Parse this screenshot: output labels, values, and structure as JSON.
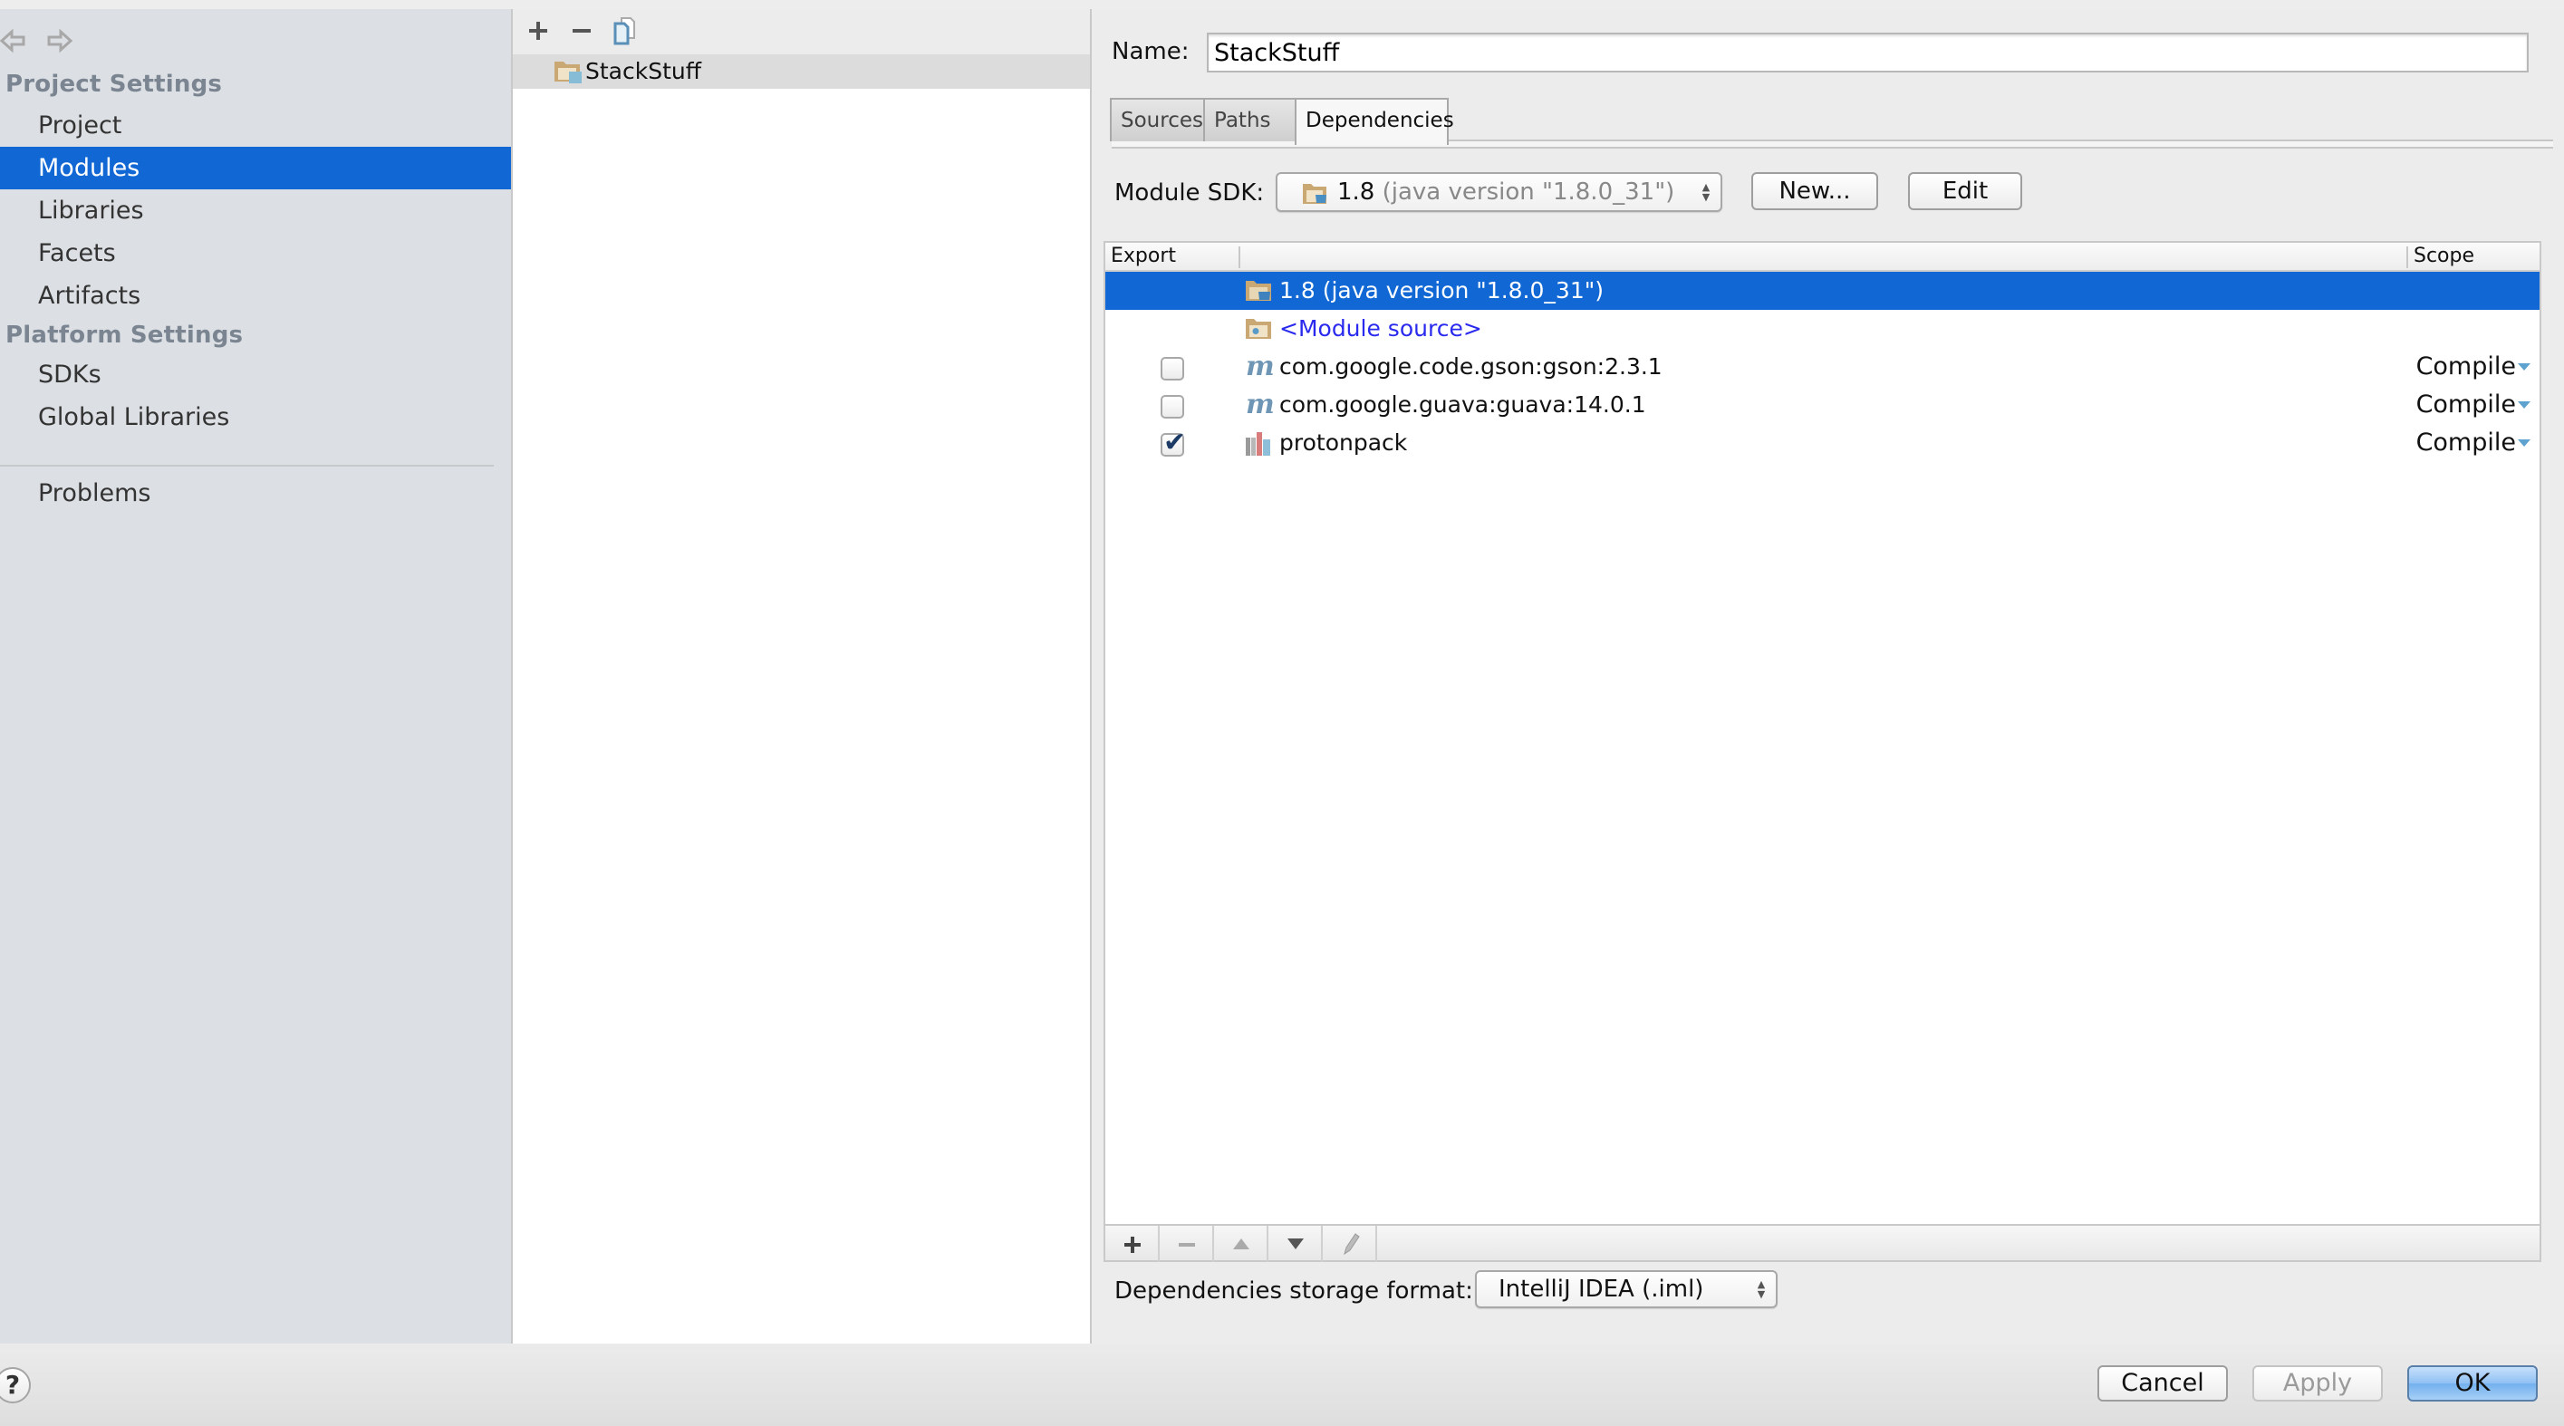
{
  "sidebar": {
    "project_settings_header": "Project Settings",
    "project_items": [
      {
        "label": "Project",
        "selected": false
      },
      {
        "label": "Modules",
        "selected": true
      },
      {
        "label": "Libraries",
        "selected": false
      },
      {
        "label": "Facets",
        "selected": false
      },
      {
        "label": "Artifacts",
        "selected": false
      }
    ],
    "platform_settings_header": "Platform Settings",
    "platform_items": [
      {
        "label": "SDKs"
      },
      {
        "label": "Global Libraries"
      }
    ],
    "problems_label": "Problems",
    "icons": {
      "back": "arrow-left-icon",
      "forward": "arrow-right-icon"
    }
  },
  "module_tree": {
    "toolbar": {
      "add": "+",
      "remove": "−",
      "copy": "copy-icon"
    },
    "items": [
      {
        "label": "StackStuff",
        "icon": "module-folder-icon",
        "selected": true
      }
    ]
  },
  "module_editor": {
    "name_label": "Name:",
    "name_value": "StackStuff",
    "tabs": [
      {
        "label": "Sources",
        "active": false
      },
      {
        "label": "Paths",
        "active": false
      },
      {
        "label": "Dependencies",
        "active": true
      }
    ],
    "sdk_label": "Module SDK:",
    "sdk_value_main": "1.8",
    "sdk_value_detail": "(java version \"1.8.0_31\")",
    "new_button": "New...",
    "edit_button": "Edit",
    "table": {
      "columns": [
        "Export",
        "",
        "Scope"
      ],
      "rows": [
        {
          "name": "1.8 (java version \"1.8.0_31\")",
          "icon": "jdk-icon",
          "has_export": false,
          "scope": "",
          "selected": true,
          "link": false
        },
        {
          "name": "<Module source>",
          "icon": "module-source-icon",
          "has_export": false,
          "scope": "",
          "selected": false,
          "link": true
        },
        {
          "name": "com.google.code.gson:gson:2.3.1",
          "icon": "maven-icon",
          "has_export": true,
          "exported": false,
          "scope": "Compile",
          "selected": false,
          "link": false
        },
        {
          "name": "com.google.guava:guava:14.0.1",
          "icon": "maven-icon",
          "has_export": true,
          "exported": false,
          "scope": "Compile",
          "selected": false,
          "link": false
        },
        {
          "name": "protonpack",
          "icon": "library-icon",
          "has_export": true,
          "exported": true,
          "scope": "Compile",
          "selected": false,
          "link": false
        }
      ],
      "toolbar": [
        "+",
        "−",
        "▲",
        "▼",
        "✎"
      ]
    },
    "storage_label": "Dependencies storage format:",
    "storage_value": "IntelliJ IDEA (.iml)"
  },
  "dialog_buttons": {
    "help": "?",
    "cancel": "Cancel",
    "apply": "Apply",
    "ok": "OK"
  },
  "colors": {
    "selection": "#1168d4",
    "link": "#2a2aee",
    "sidebar_bg": "#dcdfe3",
    "section_header": "#7a8591"
  }
}
